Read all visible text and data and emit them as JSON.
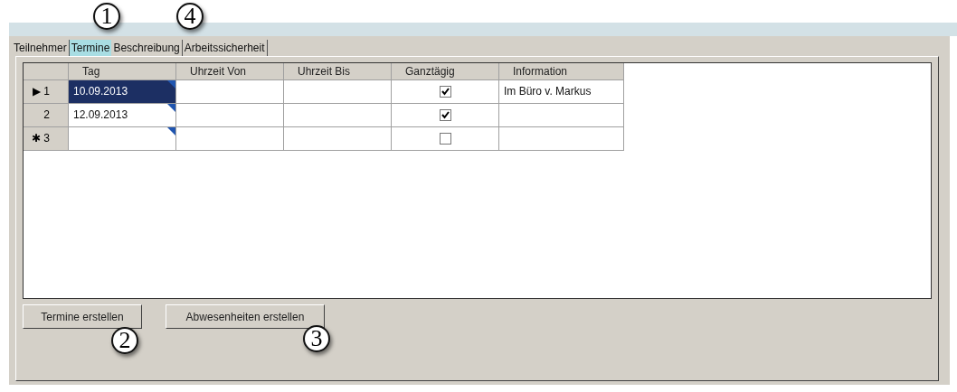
{
  "tabs": [
    {
      "label": "Teilnehmer",
      "selected": false
    },
    {
      "label": "Termine",
      "selected": true
    },
    {
      "label": "Beschreibung",
      "selected": false
    },
    {
      "label": "Arbeitssicherheit",
      "selected": false
    }
  ],
  "grid": {
    "columns": [
      "Tag",
      "Uhrzeit Von",
      "Uhrzeit Bis",
      "Ganztägig",
      "Information"
    ],
    "rows": [
      {
        "marker": "▶",
        "number": "1",
        "tag": "10.09.2013",
        "selected": true,
        "von": "",
        "bis": "",
        "checked": true,
        "information": "Im Büro v. Markus"
      },
      {
        "number": "2",
        "tag": "12.09.2013",
        "selected": false,
        "checked": true
      },
      {
        "marker": "✱",
        "number": "3",
        "selected": false,
        "checked": false
      }
    ]
  },
  "buttons": [
    "Termine erstellen",
    "Abwesenheiten erstellen"
  ],
  "callouts": [
    "1",
    "4",
    "2",
    "3"
  ]
}
